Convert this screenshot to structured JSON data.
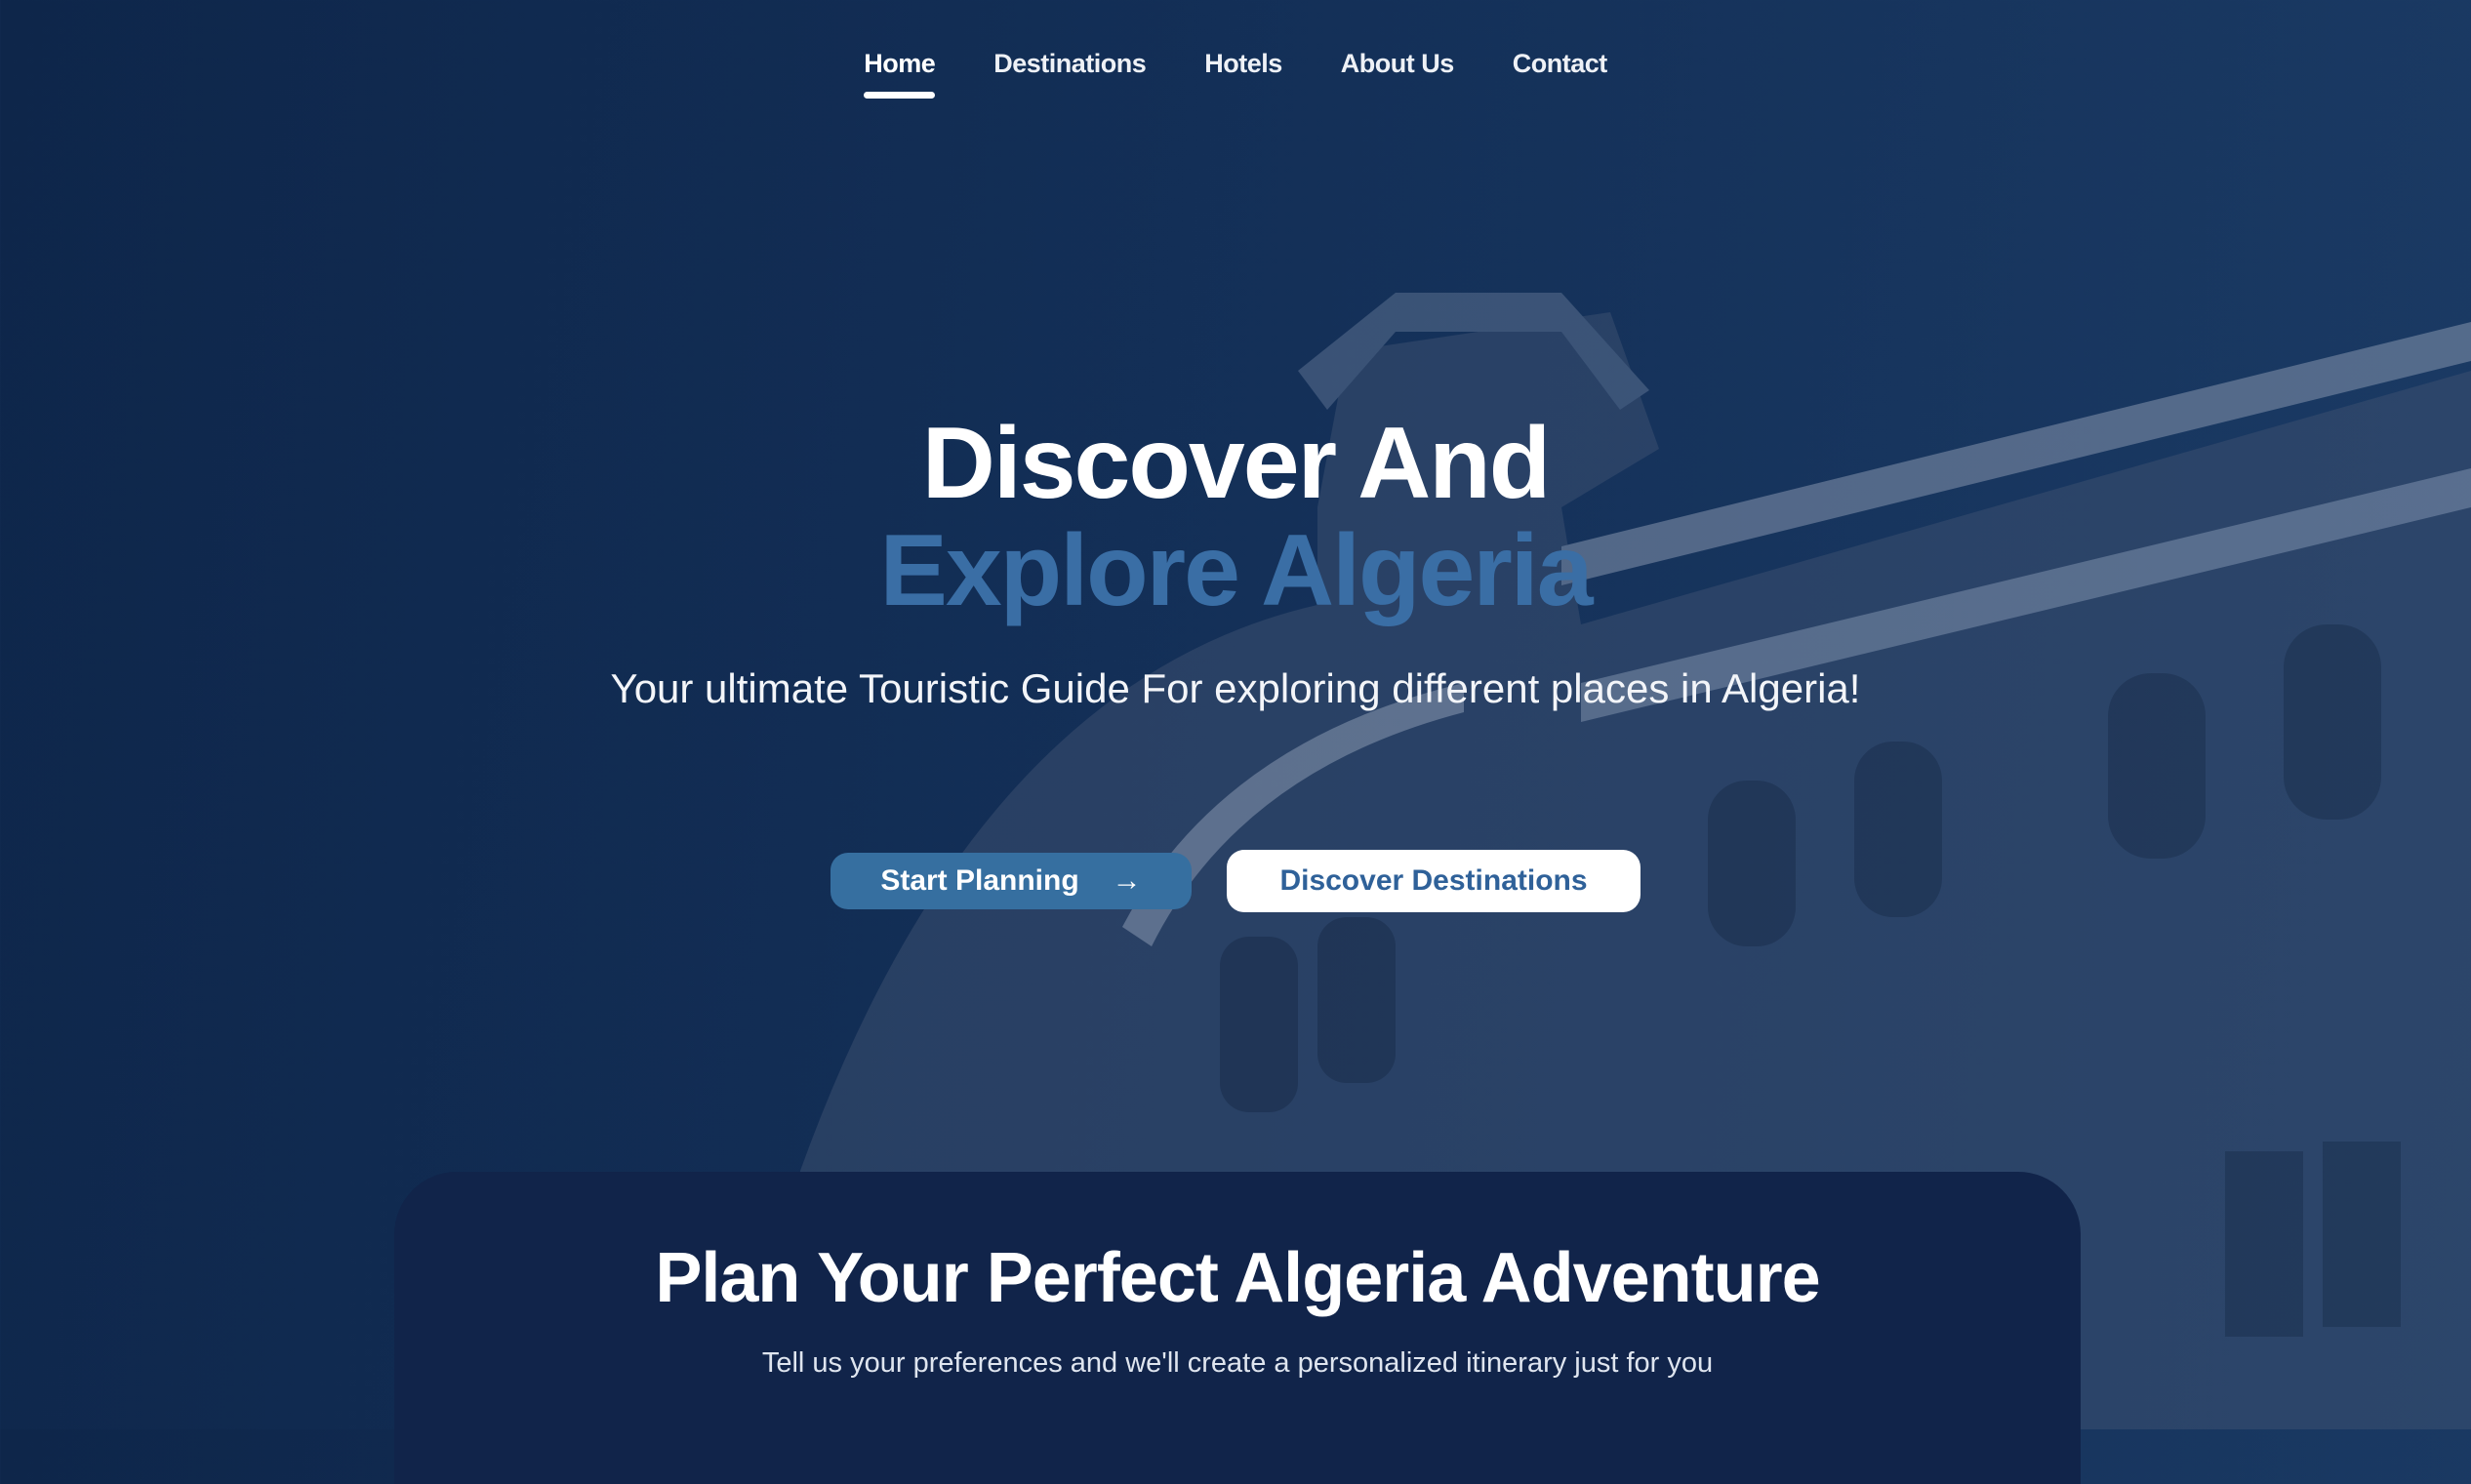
{
  "nav": {
    "items": [
      {
        "label": "Home",
        "active": true
      },
      {
        "label": "Destinations"
      },
      {
        "label": "Hotels"
      },
      {
        "label": "About Us"
      },
      {
        "label": "Contact"
      }
    ]
  },
  "hero": {
    "title_line1": "Discover And",
    "title_line2": "Explore Algeria",
    "subtitle": "Your ultimate Touristic Guide For exploring different places in Algeria!",
    "primary_button": "Start Planning",
    "primary_icon": "arrow-right-icon",
    "secondary_button": "Discover Destinations"
  },
  "planner": {
    "title": "Plan Your Perfect Algeria Adventure",
    "subtitle": "Tell us your preferences and we'll create a personalized itinerary just for you"
  },
  "colors": {
    "accent": "#366fa0",
    "title_accent": "#3a6ea5",
    "background": "#132f57",
    "card": "#11244a"
  }
}
